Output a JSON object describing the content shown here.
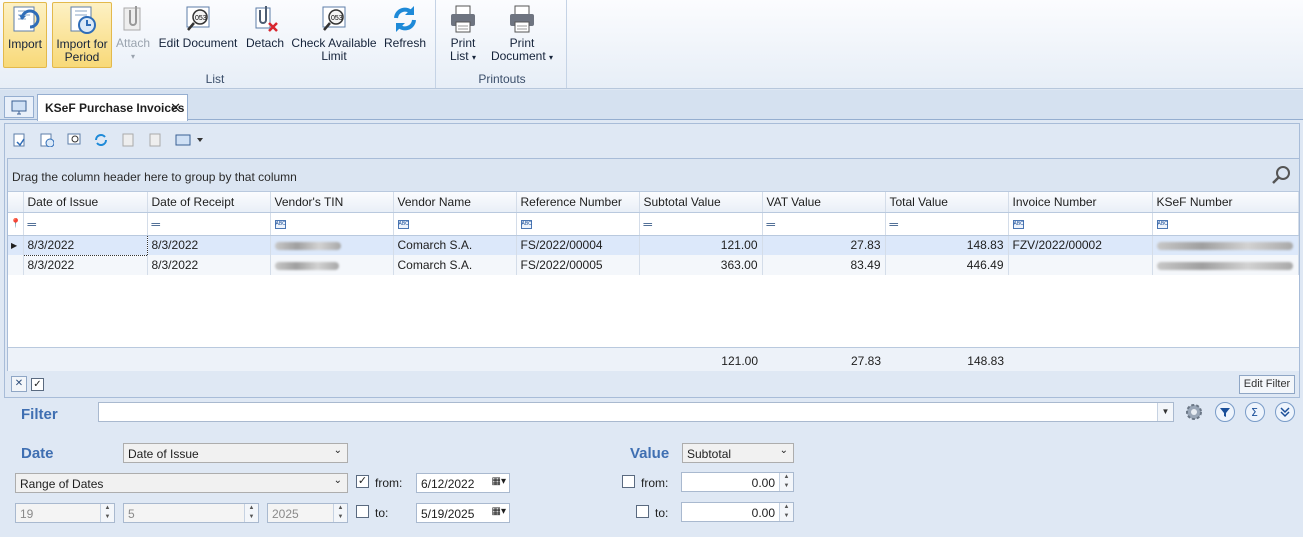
{
  "ribbon": {
    "buttons": [
      {
        "label": "Import"
      },
      {
        "label": "Import for Period"
      },
      {
        "label": "Attach"
      },
      {
        "label": "Edit Document"
      },
      {
        "label": "Detach"
      },
      {
        "label": "Check Available Limit"
      },
      {
        "label": "Refresh"
      },
      {
        "label": "Print List"
      },
      {
        "label": "Print Document"
      }
    ],
    "groups": {
      "list": "List",
      "printouts": "Printouts"
    }
  },
  "tab": {
    "title": "KSeF Purchase Invoices",
    "close": "✕"
  },
  "grid": {
    "group_hint": "Drag the column header here to group by that column",
    "columns": [
      "Date of Issue",
      "Date of Receipt",
      "Vendor's TIN",
      "Vendor Name",
      "Reference Number",
      "Subtotal Value",
      "VAT Value",
      "Total Value",
      "Invoice Number",
      "KSeF Number"
    ],
    "rows": [
      {
        "issue": "8/3/2022",
        "receipt": "8/3/2022",
        "vendor": "Comarch S.A.",
        "ref": "FS/2022/00004",
        "subtotal": "121.00",
        "vat": "27.83",
        "total": "148.83",
        "invoice": "FZV/2022/00002"
      },
      {
        "issue": "8/3/2022",
        "receipt": "8/3/2022",
        "vendor": "Comarch S.A.",
        "ref": "FS/2022/00005",
        "subtotal": "363.00",
        "vat": "83.49",
        "total": "446.49",
        "invoice": ""
      }
    ],
    "footer": {
      "subtotal": "121.00",
      "vat": "27.83",
      "total": "148.83"
    }
  },
  "status": {
    "edit_filter": "Edit Filter"
  },
  "filter": {
    "label": "Filter",
    "value": "",
    "date_label": "Date",
    "date_field": "Date of Issue",
    "range_type": "Range of Dates",
    "day": "19",
    "month": "5",
    "year": "2025",
    "from_label": "from:",
    "to_label": "to:",
    "date_from": "6/12/2022",
    "date_to": "5/19/2025",
    "value_label": "Value",
    "value_field": "Subtotal",
    "value_from": "0.00",
    "value_to": "0.00"
  },
  "colors": {
    "accent": "#3f6fb2",
    "selected_row": "#dce8fa",
    "active_button": "#f8d978"
  }
}
